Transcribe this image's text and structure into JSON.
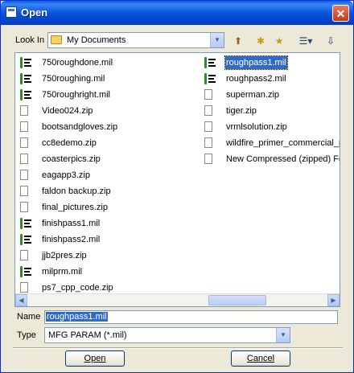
{
  "window": {
    "title": "Open",
    "close_glyph": "✕"
  },
  "look_in": {
    "label": "Look In",
    "value": "My Documents"
  },
  "toolbar": {
    "up_glyph": "⬆",
    "new_folder_glyph": "✱",
    "favorites_glyph": "★",
    "view_glyph": "☰▾",
    "tools_glyph": "⇩"
  },
  "files_col1": [
    {
      "name": "750roughdone.mil",
      "icon": "mil-file-icon"
    },
    {
      "name": "750roughing.mil",
      "icon": "mil-file-icon"
    },
    {
      "name": "750roughright.mil",
      "icon": "mil-file-icon"
    },
    {
      "name": "Video024.zip",
      "icon": "zip-file-icon"
    },
    {
      "name": "bootsandgloves.zip",
      "icon": "zip-file-icon"
    },
    {
      "name": "cc8edemo.zip",
      "icon": "zip-file-icon"
    },
    {
      "name": "coasterpics.zip",
      "icon": "zip-file-icon"
    },
    {
      "name": "eagapp3.zip",
      "icon": "zip-file-icon"
    },
    {
      "name": "faldon backup.zip",
      "icon": "zip-file-icon"
    },
    {
      "name": "final_pictures.zip",
      "icon": "zip-file-icon"
    },
    {
      "name": "finishpass1.mil",
      "icon": "mil-file-icon"
    },
    {
      "name": "finishpass2.mil",
      "icon": "mil-file-icon"
    },
    {
      "name": "jjb2pres.zip",
      "icon": "zip-file-icon"
    },
    {
      "name": "milprm.mil",
      "icon": "mil-file-icon"
    },
    {
      "name": "ps7_cpp_code.zip",
      "icon": "zip-file-icon"
    }
  ],
  "files_col2": [
    {
      "name": "roughpass1.mil",
      "icon": "mil-file-icon",
      "selected": true
    },
    {
      "name": "roughpass2.mil",
      "icon": "mil-file-icon"
    },
    {
      "name": "superman.zip",
      "icon": "zip-file-icon"
    },
    {
      "name": "tiger.zip",
      "icon": "zip-file-icon"
    },
    {
      "name": "vrmlsolution.zip",
      "icon": "zip-file-icon"
    },
    {
      "name": "wildfire_primer_commercial_pa",
      "icon": "zip-file-icon"
    },
    {
      "name": "New Compressed (zipped) Fold",
      "icon": "zip-file-icon"
    }
  ],
  "scroll": {
    "left_glyph": "◀",
    "right_glyph": "▶"
  },
  "name_field": {
    "label": "Name",
    "value": "roughpass1.mil"
  },
  "type_field": {
    "label": "Type",
    "value": "MFG PARAM (*.mil)"
  },
  "buttons": {
    "open_label": "Open",
    "cancel_label": "Cancel"
  },
  "dropdown_glyph": "▼"
}
